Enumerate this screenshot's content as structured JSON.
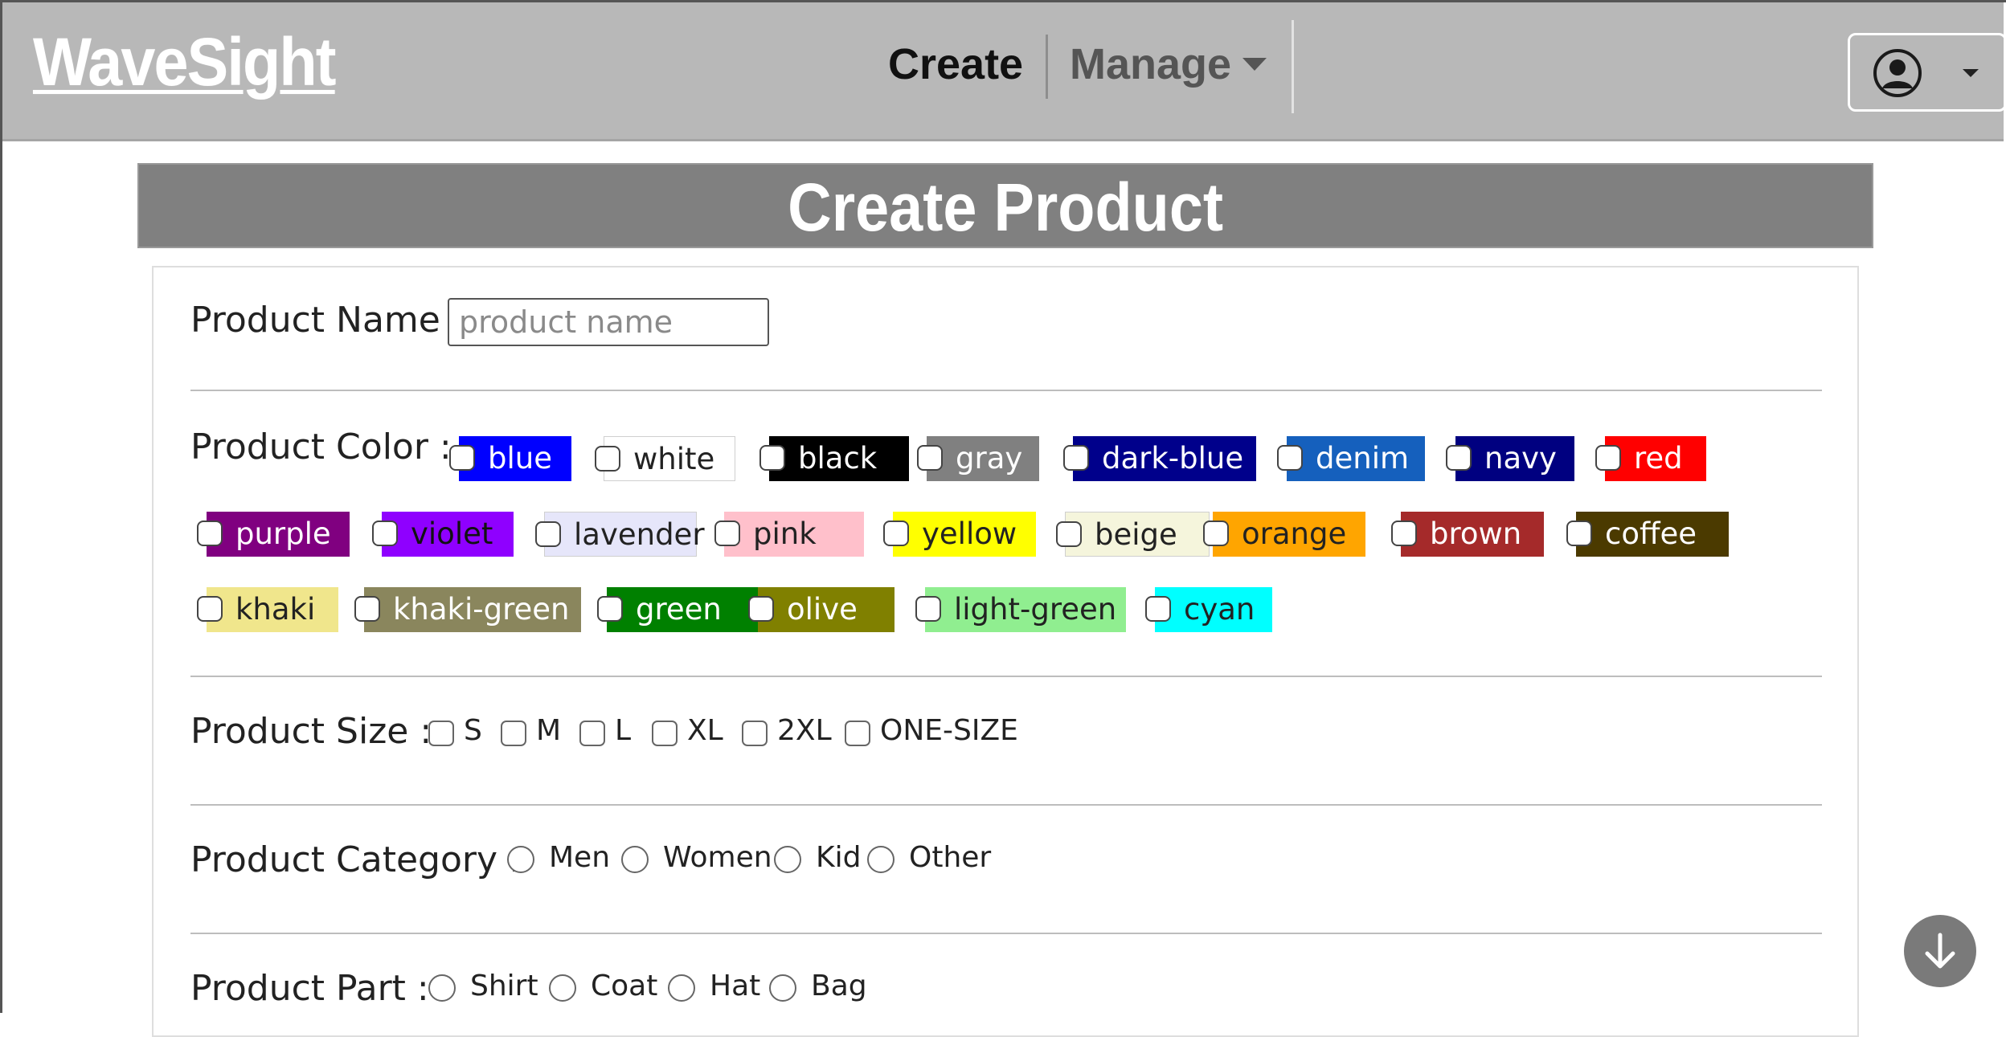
{
  "navbar": {
    "brand": "WaveSight",
    "create_label": "Create",
    "manage_label": "Manage"
  },
  "page": {
    "title": "Create Product"
  },
  "form": {
    "name_label": "Product Name :",
    "name_placeholder": "product name",
    "name_value": "",
    "color_label": "Product Color :",
    "colors": [
      {
        "name": "blue",
        "bg": "#0000ff",
        "fg": "#ffffff"
      },
      {
        "name": "white",
        "bg": "#ffffff",
        "fg": "#222222"
      },
      {
        "name": "black",
        "bg": "#000000",
        "fg": "#ffffff"
      },
      {
        "name": "gray",
        "bg": "#808080",
        "fg": "#ffffff"
      },
      {
        "name": "dark-blue",
        "bg": "#00008b",
        "fg": "#ffffff"
      },
      {
        "name": "denim",
        "bg": "#1560bd",
        "fg": "#ffffff"
      },
      {
        "name": "navy",
        "bg": "#000080",
        "fg": "#ffffff"
      },
      {
        "name": "red",
        "bg": "#ff0000",
        "fg": "#ffffff"
      },
      {
        "name": "purple",
        "bg": "#800080",
        "fg": "#ffffff"
      },
      {
        "name": "violet",
        "bg": "#8f00ff",
        "fg": "#111111"
      },
      {
        "name": "lavender",
        "bg": "#e6e6fa",
        "fg": "#222222"
      },
      {
        "name": "pink",
        "bg": "#ffc0cb",
        "fg": "#222222"
      },
      {
        "name": "yellow",
        "bg": "#ffff00",
        "fg": "#222222"
      },
      {
        "name": "beige",
        "bg": "#f5f5dc",
        "fg": "#222222"
      },
      {
        "name": "orange",
        "bg": "#ffa500",
        "fg": "#222222"
      },
      {
        "name": "brown",
        "bg": "#a52a2a",
        "fg": "#ffffff"
      },
      {
        "name": "coffee",
        "bg": "#4b3a00",
        "fg": "#ffffff"
      },
      {
        "name": "khaki",
        "bg": "#f0e68c",
        "fg": "#222222"
      },
      {
        "name": "khaki-green",
        "bg": "#8a865d",
        "fg": "#ffffff"
      },
      {
        "name": "green",
        "bg": "#008000",
        "fg": "#ffffff"
      },
      {
        "name": "olive",
        "bg": "#808000",
        "fg": "#ffffff"
      },
      {
        "name": "light-green",
        "bg": "#90ee90",
        "fg": "#222222"
      },
      {
        "name": "cyan",
        "bg": "#00ffff",
        "fg": "#222222"
      }
    ],
    "size_label": "Product Size :",
    "sizes": [
      "S",
      "M",
      "L",
      "XL",
      "2XL",
      "ONE-SIZE"
    ],
    "category_label": "Product Category :",
    "categories": [
      "Men",
      "Women",
      "Kid",
      "Other"
    ],
    "part_label": "Product Part :",
    "parts": [
      "Shirt",
      "Coat",
      "Hat",
      "Bag"
    ]
  }
}
